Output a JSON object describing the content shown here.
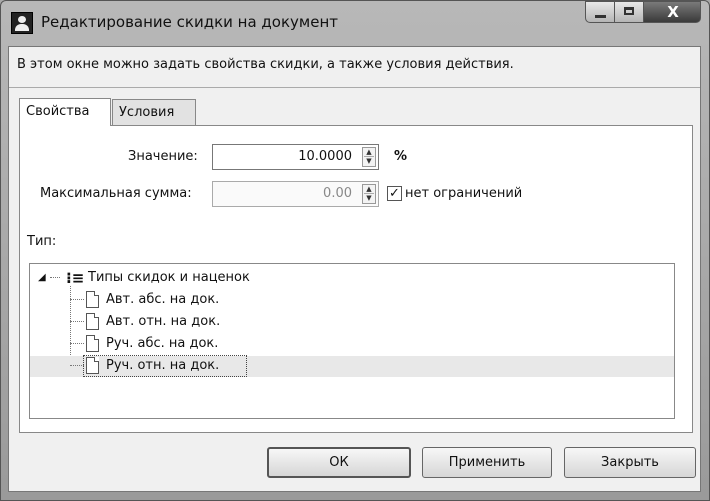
{
  "window": {
    "title": "Редактирование скидки на документ",
    "close_glyph": "X"
  },
  "description": "В этом окне можно задать свойства скидки, а также условия действия.",
  "tabs": [
    {
      "label": "Свойства",
      "active": true
    },
    {
      "label": "Условия",
      "active": false
    }
  ],
  "properties": {
    "value_label": "Значение:",
    "value": "10.0000",
    "value_unit": "%",
    "max_sum_label": "Максимальная сумма:",
    "max_sum": "0.00",
    "no_limit_checked": true,
    "no_limit_label": "нет ограничений",
    "type_label": "Тип:"
  },
  "tree": {
    "root": {
      "label": "Типы скидок и наценок",
      "expanded": true
    },
    "items": [
      {
        "label": "Авт. абс. на док."
      },
      {
        "label": "Авт. отн. на док."
      },
      {
        "label": "Руч. абс. на док."
      },
      {
        "label": "Руч. отн. на док.",
        "selected": true
      }
    ]
  },
  "buttons": {
    "ok": "ОК",
    "apply": "Применить",
    "close": "Закрыть"
  }
}
